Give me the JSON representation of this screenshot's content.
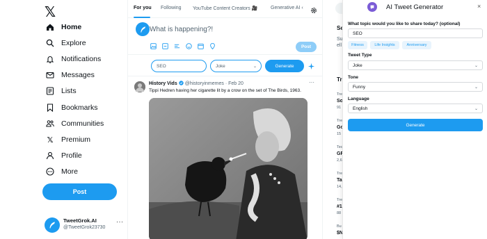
{
  "nav": {
    "items": [
      {
        "label": "Home",
        "icon": "home-icon"
      },
      {
        "label": "Explore",
        "icon": "search-icon"
      },
      {
        "label": "Notifications",
        "icon": "bell-icon"
      },
      {
        "label": "Messages",
        "icon": "envelope-icon"
      },
      {
        "label": "Lists",
        "icon": "list-icon"
      },
      {
        "label": "Bookmarks",
        "icon": "bookmark-icon"
      },
      {
        "label": "Communities",
        "icon": "people-icon"
      },
      {
        "label": "Premium",
        "icon": "x-icon"
      },
      {
        "label": "Profile",
        "icon": "person-icon"
      },
      {
        "label": "More",
        "icon": "more-circle-icon"
      }
    ],
    "post_label": "Post"
  },
  "account": {
    "name": "TweetGrok.AI",
    "handle": "@TweetGrok23730",
    "more": "···"
  },
  "tabs": [
    {
      "label": "For you"
    },
    {
      "label": "Following"
    },
    {
      "label": "YouTube Content Creators 🎥"
    },
    {
      "label": "Generative AI ‹"
    }
  ],
  "composer": {
    "placeholder": "What is happening?!",
    "post_label": "Post"
  },
  "generator_row": {
    "topic_value": "SEO",
    "type_value": "Joke",
    "generate_label": "Generate"
  },
  "tweet": {
    "name": "History Vids",
    "handle": "@historyinmemes",
    "date": "· Feb 20",
    "text": "Tippi Hedren having her cigarette lit by a crow on the set of The Birds, 1963.",
    "more": "···"
  },
  "right_column": {
    "snippets": [
      "Se",
      "Su",
      "ell",
      "Tr",
      "Tre",
      "So",
      "91",
      "Tre",
      "Go",
      "15",
      "Tec",
      "GF",
      "2,6",
      "Tre",
      "Ta",
      "14,",
      "Tre",
      "#1",
      "88",
      "Bu",
      "$N"
    ]
  },
  "panel": {
    "title": "AI Tweet Generator",
    "close": "×",
    "topic_question": "What topic would you like to share today? (optional)",
    "topic_value": "SEO",
    "chips": [
      "Fitness",
      "Life Insights",
      "Anniversary"
    ],
    "tweet_type_label": "Tweet Type",
    "tweet_type_value": "Joke",
    "tone_label": "Tone",
    "tone_value": "Funny",
    "language_label": "Language",
    "language_value": "English",
    "generate_label": "Generate"
  },
  "colors": {
    "accent": "#1d9bf0",
    "accent_light": "#8ecdf8",
    "panel_logo": "#7b5cd6"
  }
}
